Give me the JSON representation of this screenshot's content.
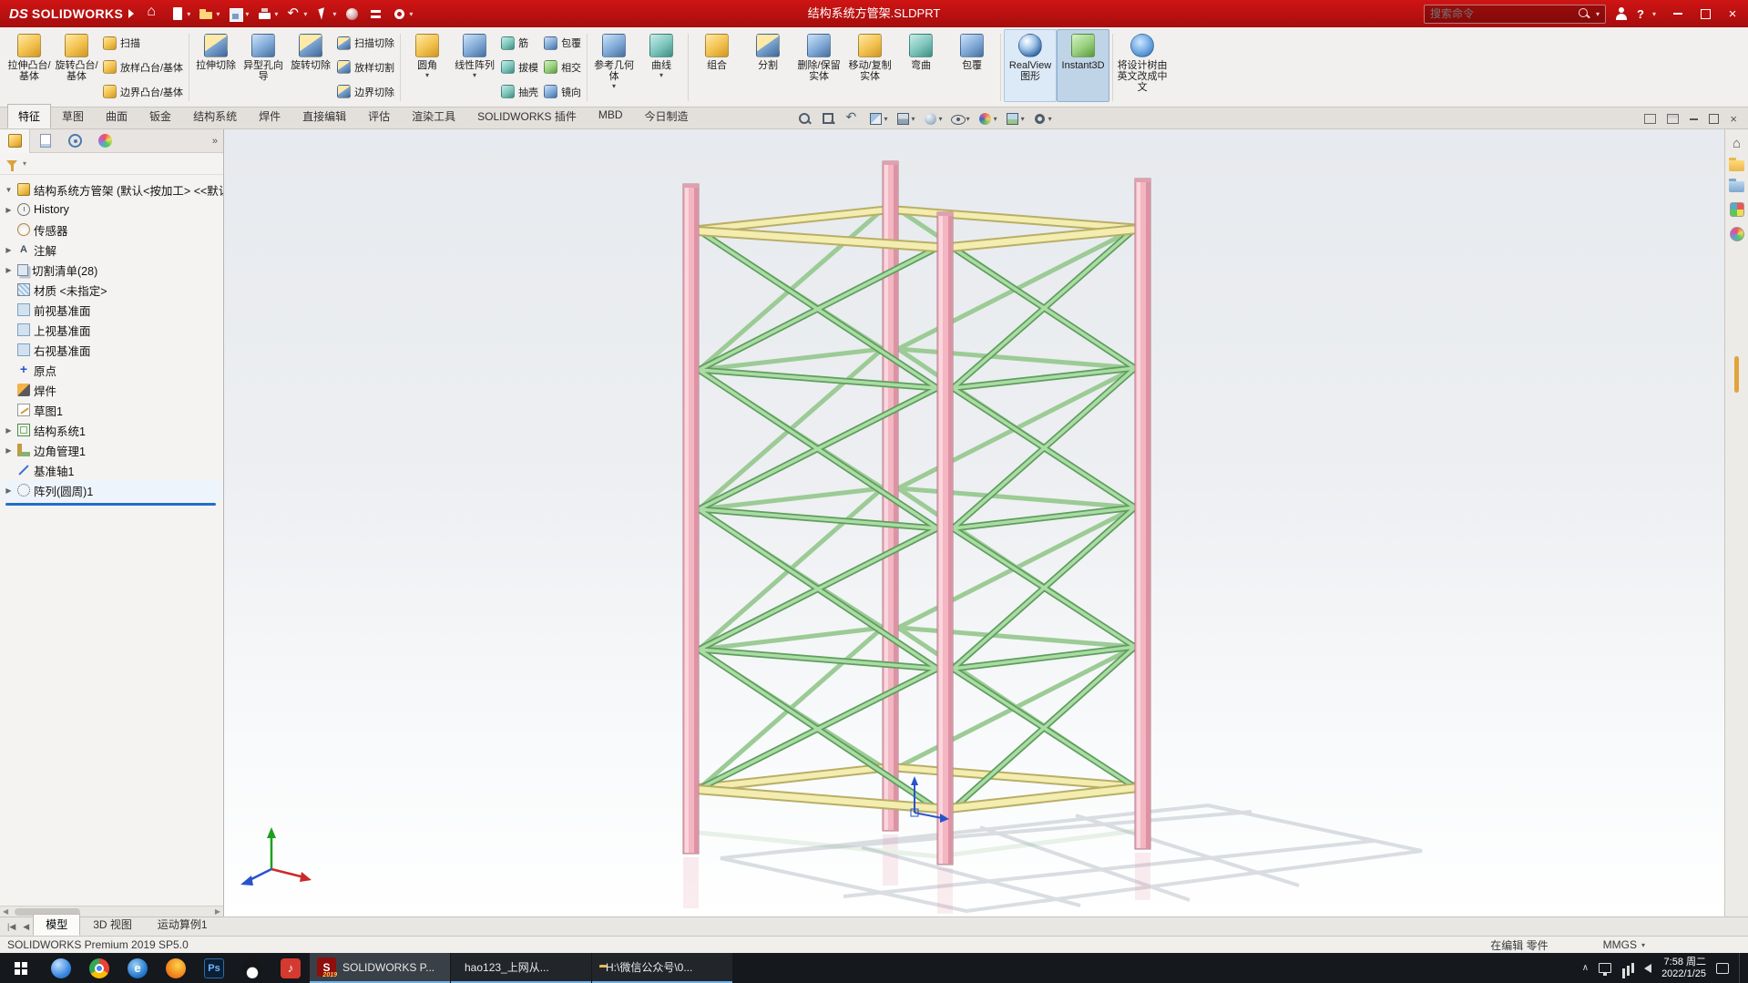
{
  "title_bar": {
    "brand_prefix": "DS",
    "brand": "SOLIDWORKS",
    "document_title": "结构系统方管架.SLDPRT",
    "search_placeholder": "搜索命令",
    "help_label": "?"
  },
  "ribbon": {
    "group_boss": {
      "large": [
        {
          "label": "拉伸凸台/基体",
          "ic": "ic-gold",
          "caret": ""
        },
        {
          "label": "旋转凸台/基体",
          "ic": "ic-gold",
          "caret": ""
        }
      ],
      "small": [
        {
          "label": "扫描",
          "ic": "ic-gold",
          "caret": ""
        },
        {
          "label": "放样凸台/基体",
          "ic": "ic-gold",
          "caret": ""
        },
        {
          "label": "边界凸台/基体",
          "ic": "ic-gold",
          "caret": ""
        }
      ]
    },
    "group_cut": {
      "large": [
        {
          "label": "拉伸切除",
          "ic": "ic-goldblue",
          "caret": ""
        },
        {
          "label": "异型孔向导",
          "ic": "ic-blue",
          "caret": ""
        },
        {
          "label": "旋转切除",
          "ic": "ic-goldblue",
          "caret": ""
        }
      ],
      "small": [
        {
          "label": "扫描切除",
          "ic": "ic-goldblue",
          "caret": ""
        },
        {
          "label": "放样切割",
          "ic": "ic-goldblue",
          "caret": ""
        },
        {
          "label": "边界切除",
          "ic": "ic-goldblue",
          "caret": ""
        }
      ]
    },
    "group_pattern": {
      "large": [
        {
          "label": "圆角",
          "ic": "ic-gold",
          "caret": "▾"
        },
        {
          "label": "线性阵列",
          "ic": "ic-blue",
          "caret": "▾"
        }
      ],
      "small": [
        {
          "label": "筋",
          "ic": "ic-teal",
          "caret": ""
        },
        {
          "label": "拔模",
          "ic": "ic-teal",
          "caret": ""
        },
        {
          "label": "抽壳",
          "ic": "ic-teal",
          "caret": ""
        }
      ],
      "small2": [
        {
          "label": "包覆",
          "ic": "ic-blue",
          "caret": ""
        },
        {
          "label": "相交",
          "ic": "ic-green",
          "caret": ""
        },
        {
          "label": "镜向",
          "ic": "ic-blue",
          "caret": ""
        }
      ]
    },
    "group_ref": {
      "large": [
        {
          "label": "参考几何体",
          "ic": "ic-blue",
          "caret": "▾"
        },
        {
          "label": "曲线",
          "ic": "ic-teal",
          "caret": "▾"
        }
      ]
    },
    "group_body": {
      "large": [
        {
          "label": "组合",
          "ic": "ic-gold",
          "caret": ""
        },
        {
          "label": "分割",
          "ic": "ic-goldblue",
          "caret": ""
        },
        {
          "label": "删除/保留实体",
          "ic": "ic-blue",
          "caret": ""
        },
        {
          "label": "移动/复制实体",
          "ic": "ic-gold",
          "caret": ""
        },
        {
          "label": "弯曲",
          "ic": "ic-teal",
          "caret": ""
        },
        {
          "label": "包覆",
          "ic": "ic-blue",
          "caret": ""
        }
      ]
    },
    "group_view": {
      "large": [
        {
          "label": "RealView图形",
          "ic": "ic-sphere",
          "caret": "",
          "state": "hl"
        },
        {
          "label": "Instant3D",
          "ic": "ic-green",
          "caret": "",
          "state": "hl2"
        }
      ]
    },
    "group_lang": {
      "large": [
        {
          "label": "将设计树由英文改成中文",
          "ic": "ic-globe",
          "caret": ""
        }
      ]
    }
  },
  "tabs": [
    {
      "label": "特征",
      "state": "active"
    },
    {
      "label": "草图",
      "state": ""
    },
    {
      "label": "曲面",
      "state": ""
    },
    {
      "label": "钣金",
      "state": ""
    },
    {
      "label": "结构系统",
      "state": ""
    },
    {
      "label": "焊件",
      "state": ""
    },
    {
      "label": "直接编辑",
      "state": ""
    },
    {
      "label": "评估",
      "state": ""
    },
    {
      "label": "渲染工具",
      "state": ""
    },
    {
      "label": "SOLIDWORKS 插件",
      "state": ""
    },
    {
      "label": "MBD",
      "state": ""
    },
    {
      "label": "今日制造",
      "state": ""
    }
  ],
  "hud_icons": [
    {
      "name": "zoom-fit-icon",
      "ic": "hud-zoom-fit",
      "caret": ""
    },
    {
      "name": "zoom-area-icon",
      "ic": "hud-zoom-area",
      "caret": ""
    },
    {
      "name": "previous-view-icon",
      "ic": "hud-previous-view",
      "caret": ""
    },
    {
      "name": "section-view-icon",
      "ic": "hud-section-view",
      "caret": "▾"
    },
    {
      "name": "view-orientation-icon",
      "ic": "hud-view-orientation",
      "caret": "▾"
    },
    {
      "name": "display-style-icon",
      "ic": "hud-display-style",
      "caret": "▾"
    },
    {
      "name": "hide-show-items-icon",
      "ic": "hud-hide-show",
      "caret": "▾"
    },
    {
      "name": "edit-appearance-icon",
      "ic": "hud-edit-appearance",
      "caret": "▾"
    },
    {
      "name": "apply-scene-icon",
      "ic": "hud-apply-scene",
      "caret": "▾"
    },
    {
      "name": "view-settings-icon",
      "ic": "hud-view-settings",
      "caret": "▾"
    }
  ],
  "feature_tree": {
    "root": "结构系统方管架 (默认<按加工> <<默认",
    "root_arrow": "▼",
    "items": [
      {
        "label": "History",
        "icon": "ti-history",
        "icon_name": "history-icon",
        "arrow": "▶",
        "state": ""
      },
      {
        "label": "传感器",
        "icon": "ti-sensor",
        "icon_name": "sensors-icon",
        "arrow": "",
        "state": ""
      },
      {
        "label": "注解",
        "icon": "ti-annot",
        "icon_name": "annotations-icon",
        "arrow": "▶",
        "state": ""
      },
      {
        "label": "切割清单(28)",
        "icon": "ti-cutlist",
        "icon_name": "cut-list-icon",
        "arrow": "▶",
        "state": ""
      },
      {
        "label": "材质 <未指定>",
        "icon": "ti-material",
        "icon_name": "material-icon",
        "arrow": "",
        "state": ""
      },
      {
        "label": "前视基准面",
        "icon": "ti-plane",
        "icon_name": "front-plane-icon",
        "arrow": "",
        "state": ""
      },
      {
        "label": "上视基准面",
        "icon": "ti-plane",
        "icon_name": "top-plane-icon",
        "arrow": "",
        "state": ""
      },
      {
        "label": "右视基准面",
        "icon": "ti-plane",
        "icon_name": "right-plane-icon",
        "arrow": "",
        "state": ""
      },
      {
        "label": "原点",
        "icon": "ti-origin",
        "icon_name": "origin-icon",
        "arrow": "",
        "state": ""
      },
      {
        "label": "焊件",
        "icon": "ti-weld",
        "icon_name": "weldment-icon",
        "arrow": "",
        "state": ""
      },
      {
        "label": "草图1",
        "icon": "ti-sketch",
        "icon_name": "sketch-icon",
        "arrow": "",
        "state": ""
      },
      {
        "label": "结构系统1",
        "icon": "ti-structure",
        "icon_name": "structure-system-icon",
        "arrow": "▶",
        "state": ""
      },
      {
        "label": "边角管理1",
        "icon": "ti-corner",
        "icon_name": "corner-management-icon",
        "arrow": "▶",
        "state": ""
      },
      {
        "label": "基准轴1",
        "icon": "ti-axis",
        "icon_name": "axis-icon",
        "arrow": "",
        "state": ""
      },
      {
        "label": "阵列(圆周)1",
        "icon": "ti-pattern",
        "icon_name": "circular-pattern-icon",
        "arrow": "▶",
        "state": "selected"
      }
    ]
  },
  "doc_tabs": [
    {
      "label": "模型",
      "state": "active"
    },
    {
      "label": "3D 视图",
      "state": ""
    },
    {
      "label": "运动算例1",
      "state": ""
    }
  ],
  "status_bar": {
    "left": "SOLIDWORKS Premium 2019 SP5.0",
    "editing": "在编辑 零件",
    "units": "MMGS",
    "units_caret": "▾"
  },
  "taskbar": {
    "windows": [
      {
        "label": "SOLIDWORKS P...",
        "icon": "tb-sw",
        "icon_name": "solidworks-app-icon",
        "sw_glyph": "S",
        "badge": "2019",
        "state": "active"
      },
      {
        "label": "hao123_上网从...",
        "icon": "tb-hao",
        "icon_name": "hao123-app-icon",
        "sw_glyph": "",
        "badge": "",
        "state": ""
      },
      {
        "label": "H:\\微信公众号\\0...",
        "icon": "tb-folder",
        "icon_name": "folder-window-icon",
        "sw_glyph": "",
        "badge": "",
        "state": ""
      }
    ],
    "clock_time": "7:58 周二",
    "clock_date": "2022/1/25"
  }
}
